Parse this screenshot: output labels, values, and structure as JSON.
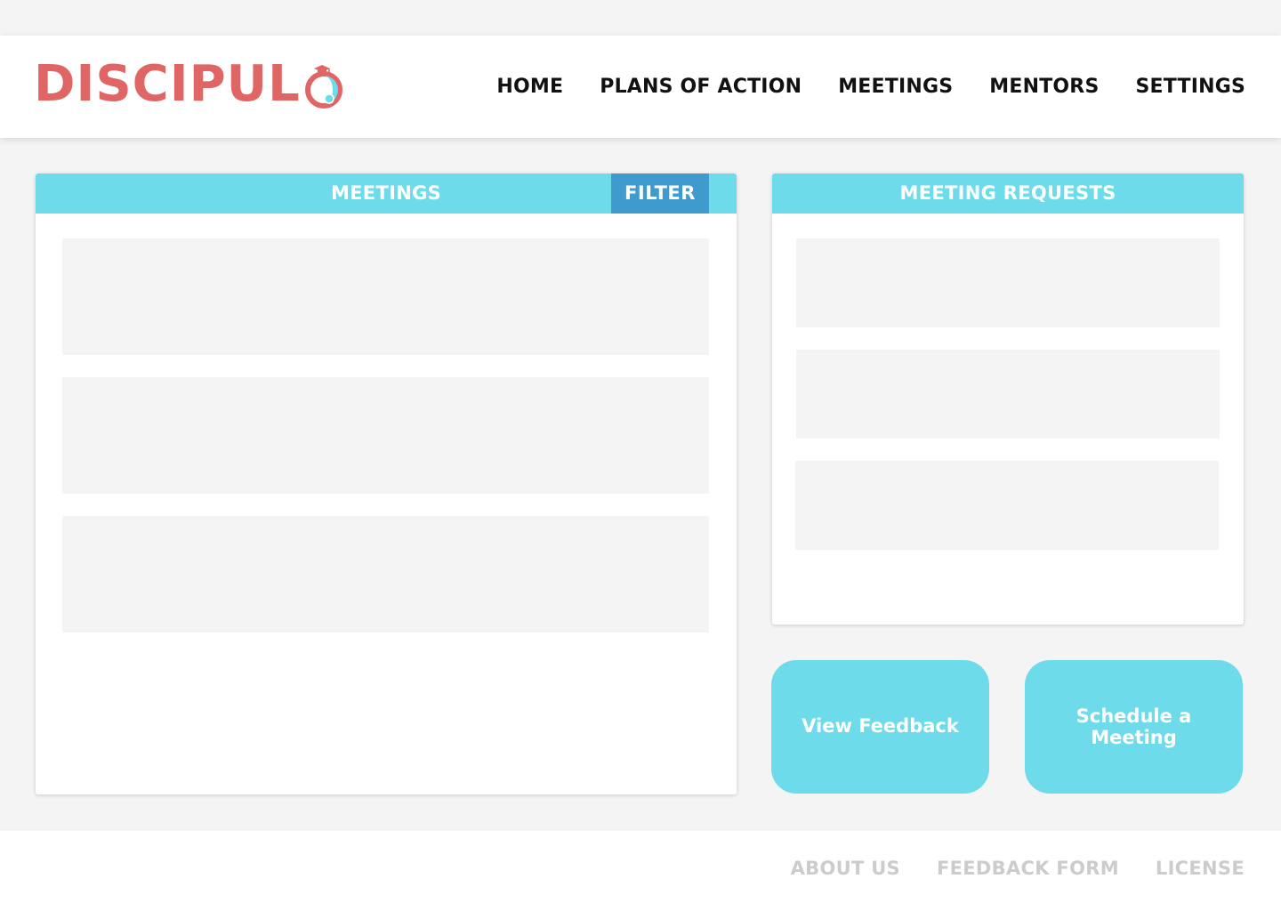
{
  "brand": {
    "name": "DISCIPULO",
    "logo_text": "DISCIPUL",
    "logo_icon": "graduation-cap-o-icon",
    "color": "#e06666",
    "accent": "#6ddbe9"
  },
  "nav": {
    "items": [
      {
        "label": "HOME"
      },
      {
        "label": "PLANS OF ACTION"
      },
      {
        "label": "MEETINGS"
      },
      {
        "label": "MENTORS"
      },
      {
        "label": "SETTINGS"
      }
    ]
  },
  "meetings_panel": {
    "title": "MEETINGS",
    "filter_label": "FILTER",
    "filter_color": "#3f9bcd"
  },
  "requests_panel": {
    "title": "MEETING REQUESTS"
  },
  "actions": {
    "view_feedback": "View Feedback",
    "schedule_meeting": "Schedule a Meeting"
  },
  "footer": {
    "links": [
      {
        "label": "ABOUT US"
      },
      {
        "label": "FEEDBACK FORM"
      },
      {
        "label": "LICENSE"
      }
    ]
  }
}
